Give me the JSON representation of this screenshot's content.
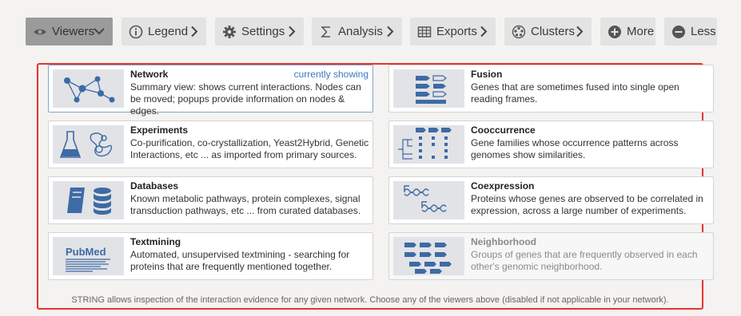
{
  "toolbar": {
    "viewers": {
      "label": "Viewers",
      "icon": "eye-icon"
    },
    "legend": {
      "label": "Legend",
      "icon": "info-icon"
    },
    "settings": {
      "label": "Settings",
      "icon": "gear-icon"
    },
    "analysis": {
      "label": "Analysis",
      "icon": "sigma-icon"
    },
    "exports": {
      "label": "Exports",
      "icon": "table-icon"
    },
    "clusters": {
      "label": "Clusters",
      "icon": "cluster-icon"
    },
    "more": {
      "label": "More",
      "icon": "plus-circle-icon"
    },
    "less": {
      "label": "Less",
      "icon": "minus-circle-icon"
    }
  },
  "viewers": [
    {
      "title": "Network",
      "status": "currently showing",
      "desc": "Summary view: shows current interactions. Nodes can be moved; popups provide information on nodes & edges.",
      "icon": "network-thumbnail"
    },
    {
      "title": "Fusion",
      "status": "",
      "desc": "Genes that are sometimes fused into single open reading frames.",
      "icon": "fusion-thumbnail"
    },
    {
      "title": "Experiments",
      "status": "",
      "desc": "Co-purification, co-crystallization, Yeast2Hybrid, Genetic Interactions, etc ... as imported from primary sources.",
      "icon": "experiments-thumbnail"
    },
    {
      "title": "Cooccurrence",
      "status": "",
      "desc": "Gene families whose occurrence patterns across genomes show similarities.",
      "icon": "cooccurrence-thumbnail"
    },
    {
      "title": "Databases",
      "status": "",
      "desc": "Known metabolic pathways, protein complexes, signal transduction pathways, etc ... from curated databases.",
      "icon": "databases-thumbnail"
    },
    {
      "title": "Coexpression",
      "status": "",
      "desc": "Proteins whose genes are observed to be correlated in expression, across a large number of experiments.",
      "icon": "coexpression-thumbnail"
    },
    {
      "title": "Textmining",
      "status": "",
      "desc": "Automated, unsupervised textmining - searching for proteins that are frequently mentioned together.",
      "icon": "pubmed-thumbnail",
      "logo_text": "PubMed"
    },
    {
      "title": "Neighborhood",
      "status": "",
      "desc": "Groups of genes that are frequently observed in each other's genomic neighborhood.",
      "icon": "neighborhood-thumbnail"
    }
  ],
  "footer": "STRING allows inspection of the interaction evidence for any given network. Choose any of the viewers above (disabled if not applicable in your network).",
  "colors": {
    "accent_border": "#e5342e",
    "thumb_blue": "#3e6aa6",
    "link": "#3a7bbf"
  }
}
